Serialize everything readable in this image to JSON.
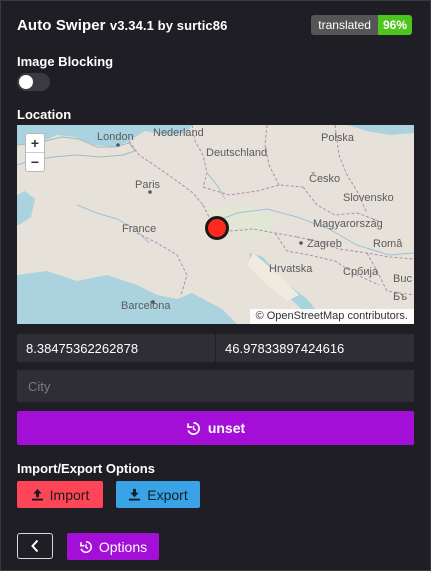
{
  "header": {
    "app_name": "Auto Swiper",
    "version_text": "v3.34.1 by surtic86",
    "badge_label": "translated",
    "badge_value": "96%"
  },
  "image_blocking": {
    "label": "Image Blocking",
    "enabled": false
  },
  "location": {
    "label": "Location",
    "map": {
      "zoom_in": "+",
      "zoom_out": "−",
      "attribution_prefix": "© ",
      "attribution_link": "OpenStreetMap",
      "attribution_suffix": " contributors.",
      "place_labels": {
        "london": "London",
        "nederland": "Nederland",
        "polska": "Polska",
        "deutschland": "Deutschland",
        "paris": "Paris",
        "cesko": "Česko",
        "slovensko": "Slovensko",
        "france": "France",
        "magyarorszag": "Magyarország",
        "zagreb": "Zagreb",
        "romania": "Româ",
        "hrvatska": "Hrvatska",
        "srbija": "Србија",
        "bucuresti": "Buc",
        "barcelona": "Barcelona",
        "bulgaria": "Бъ"
      }
    },
    "longitude": "8.38475362262878",
    "latitude": "46.97833897424616",
    "city_placeholder": "City",
    "unset_label": "unset"
  },
  "import_export": {
    "label": "Import/Export Options",
    "import_label": "Import",
    "export_label": "Export"
  },
  "footer": {
    "back_icon": "chevron-left-icon",
    "options_label": "Options"
  },
  "colors": {
    "background": "#1f1e24",
    "accent_purple": "#a40fd8",
    "import_red": "#ff4558",
    "export_blue": "#3aa3e6",
    "badge_green": "#4cc51d",
    "marker_red": "#ff2a1d"
  }
}
